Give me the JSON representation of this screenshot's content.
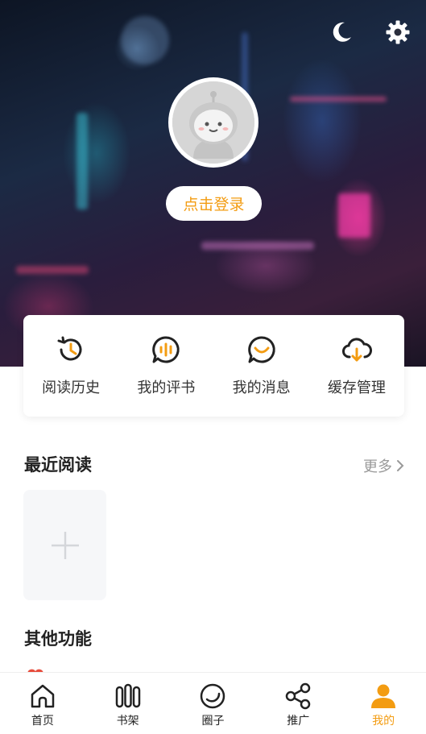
{
  "theme": {
    "accent": "#f39c12",
    "text_dark": "#222222",
    "muted": "#999999"
  },
  "header": {
    "night_mode_icon": "moon-icon",
    "settings_icon": "gear-icon",
    "avatar_icon": "robot-avatar-icon",
    "login_label": "点击登录"
  },
  "quick_actions": [
    {
      "label": "阅读历史",
      "icon": "history-icon"
    },
    {
      "label": "我的评书",
      "icon": "review-icon"
    },
    {
      "label": "我的消息",
      "icon": "message-icon"
    },
    {
      "label": "缓存管理",
      "icon": "cloud-download-icon"
    }
  ],
  "recent": {
    "title": "最近阅读",
    "more_label": "更多",
    "add_icon": "plus-icon"
  },
  "other": {
    "title": "其他功能"
  },
  "tabbar": {
    "items": [
      {
        "label": "首页",
        "icon": "home-icon"
      },
      {
        "label": "书架",
        "icon": "bookshelf-icon"
      },
      {
        "label": "圈子",
        "icon": "circle-icon"
      },
      {
        "label": "推广",
        "icon": "share-icon"
      },
      {
        "label": "我的",
        "icon": "person-icon"
      }
    ],
    "active": "我的"
  }
}
